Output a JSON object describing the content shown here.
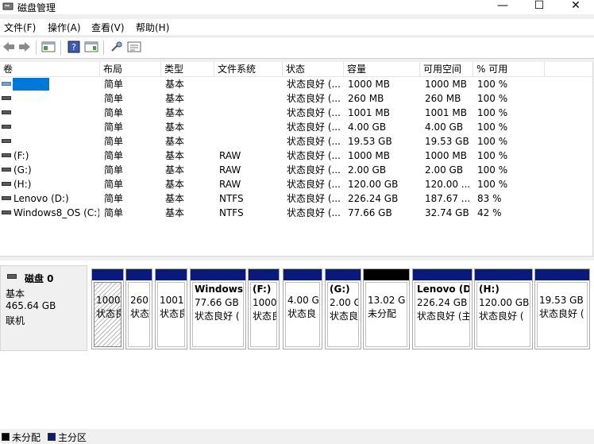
{
  "window": {
    "title": "磁盘管理",
    "minimize": "—",
    "maximize": "☐",
    "close": "✕"
  },
  "menu": [
    "文件(F)",
    "操作(A)",
    "查看(V)",
    "帮助(H)"
  ],
  "toolbar_icons": [
    "back-arrow-icon",
    "forward-arrow-icon",
    "show-pane-icon",
    "help-icon",
    "properties-icon",
    "connect-icon",
    "view-icon"
  ],
  "columns": [
    "卷",
    "布局",
    "类型",
    "文件系统",
    "状态",
    "容量",
    "可用空间",
    "% 可用"
  ],
  "volumes": [
    {
      "name": "",
      "layout": "简单",
      "type": "基本",
      "fs": "",
      "status": "状态良好 (...",
      "capacity": "1000 MB",
      "free": "1000 MB",
      "pct": "100 %"
    },
    {
      "name": "",
      "layout": "简单",
      "type": "基本",
      "fs": "",
      "status": "状态良好 (...",
      "capacity": "260 MB",
      "free": "260 MB",
      "pct": "100 %"
    },
    {
      "name": "",
      "layout": "简单",
      "type": "基本",
      "fs": "",
      "status": "状态良好 (...",
      "capacity": "1001 MB",
      "free": "1001 MB",
      "pct": "100 %"
    },
    {
      "name": "",
      "layout": "简单",
      "type": "基本",
      "fs": "",
      "status": "状态良好 (...",
      "capacity": "4.00 GB",
      "free": "4.00 GB",
      "pct": "100 %"
    },
    {
      "name": "",
      "layout": "简单",
      "type": "基本",
      "fs": "",
      "status": "状态良好 (...",
      "capacity": "19.53 GB",
      "free": "19.53 GB",
      "pct": "100 %"
    },
    {
      "name": "(F:)",
      "layout": "简单",
      "type": "基本",
      "fs": "RAW",
      "status": "状态良好 (...",
      "capacity": "1000 MB",
      "free": "1000 MB",
      "pct": "100 %"
    },
    {
      "name": "(G:)",
      "layout": "简单",
      "type": "基本",
      "fs": "RAW",
      "status": "状态良好 (...",
      "capacity": "2.00 GB",
      "free": "2.00 GB",
      "pct": "100 %"
    },
    {
      "name": "(H:)",
      "layout": "简单",
      "type": "基本",
      "fs": "RAW",
      "status": "状态良好 (...",
      "capacity": "120.00 GB",
      "free": "120.00 ...",
      "pct": "100 %"
    },
    {
      "name": "Lenovo (D:)",
      "layout": "简单",
      "type": "基本",
      "fs": "NTFS",
      "status": "状态良好 (...",
      "capacity": "226.24 GB",
      "free": "187.67 ...",
      "pct": "83 %"
    },
    {
      "name": "Windows8_OS (C:)",
      "layout": "简单",
      "type": "基本",
      "fs": "NTFS",
      "status": "状态良好 (...",
      "capacity": "77.66 GB",
      "free": "32.74 GB",
      "pct": "42 %"
    }
  ],
  "disk": {
    "name": "磁盘 0",
    "type": "基本",
    "size": "465.64 GB",
    "state": "联机"
  },
  "partitions": [
    {
      "title": "",
      "size": "1000",
      "status": "状态良",
      "bar": "blue",
      "hatch": true
    },
    {
      "title": "",
      "size": "260",
      "status": "状态",
      "bar": "blue"
    },
    {
      "title": "",
      "size": "1001",
      "status": "状态良",
      "bar": "blue"
    },
    {
      "title": "Windows",
      "size": "77.66 GB",
      "status": "状态良好 (",
      "bar": "blue"
    },
    {
      "title": "(F:)",
      "size": "1000",
      "status": "状态良",
      "bar": "blue"
    },
    {
      "title": "",
      "size": "4.00 G",
      "status": "状态良",
      "bar": "blue"
    },
    {
      "title": "(G:)",
      "size": "2.00 G",
      "status": "状态良",
      "bar": "blue"
    },
    {
      "title": "",
      "size": "13.02 G",
      "status": "未分配",
      "bar": "black"
    },
    {
      "title": "Lenovo (D",
      "size": "226.24 GB",
      "status": "状态良好 (主",
      "bar": "blue"
    },
    {
      "title": "(H:)",
      "size": "120.00 GB",
      "status": "状态良好 (",
      "bar": "blue"
    },
    {
      "title": "",
      "size": "19.53 GB",
      "status": "状态良好 (",
      "bar": "blue"
    }
  ],
  "legend": [
    {
      "label": "未分配",
      "color": "#000000"
    },
    {
      "label": "主分区",
      "color": "#0a1a7a"
    }
  ]
}
